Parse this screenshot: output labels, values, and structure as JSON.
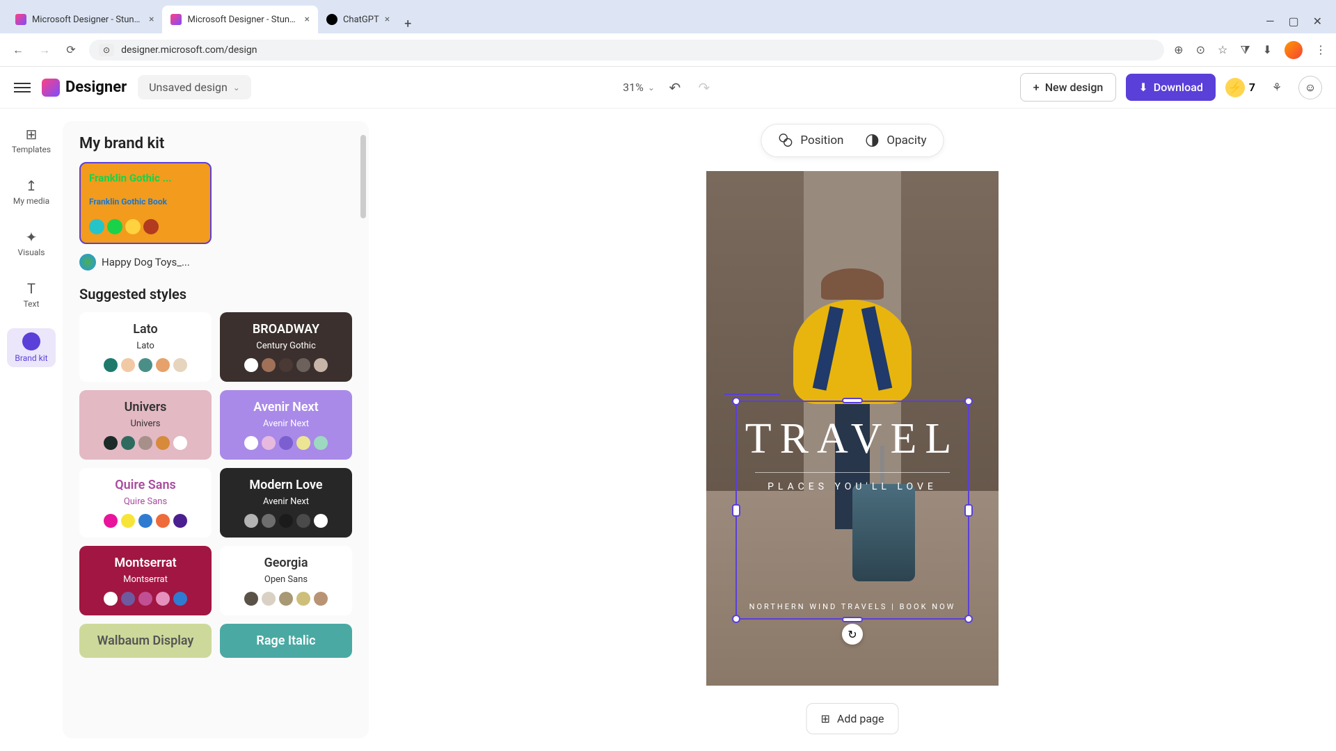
{
  "browser": {
    "tabs": [
      {
        "title": "Microsoft Designer - Stunning",
        "active": false,
        "favicon": "ms"
      },
      {
        "title": "Microsoft Designer - Stunning",
        "active": true,
        "favicon": "ms"
      },
      {
        "title": "ChatGPT",
        "active": false,
        "favicon": "gpt"
      }
    ],
    "url": "designer.microsoft.com/design"
  },
  "header": {
    "logo_text": "Designer",
    "design_name": "Unsaved design",
    "zoom": "31%",
    "new_design_label": "New design",
    "download_label": "Download",
    "credits": "7"
  },
  "nav_rail": [
    {
      "id": "templates",
      "label": "Templates",
      "icon": "⊞"
    },
    {
      "id": "my-media",
      "label": "My media",
      "icon": "↥"
    },
    {
      "id": "visuals",
      "label": "Visuals",
      "icon": "✦"
    },
    {
      "id": "text",
      "label": "Text",
      "icon": "T"
    },
    {
      "id": "brand-kit",
      "label": "Brand kit",
      "icon": "●",
      "active": true
    }
  ],
  "panel": {
    "brand_kit_title": "My brand kit",
    "brand_card": {
      "line1": "Franklin Gothic ...",
      "line2": "Franklin Gothic Book",
      "swatches": [
        "#25c4c9",
        "#19d24a",
        "#ffd23f",
        "#b23a1f"
      ]
    },
    "brand_name": "Happy Dog Toys_...",
    "suggested_title": "Suggested styles",
    "styles": [
      {
        "name1": "Lato",
        "name2": "Lato",
        "bg": "#ffffff",
        "fg": "#333",
        "swatches": [
          "#1f7a6b",
          "#f2c9a5",
          "#4a8f87",
          "#e6a26a",
          "#e7d4be"
        ]
      },
      {
        "name1": "BROADWAY",
        "name2": "Century Gothic",
        "bg": "#3b302d",
        "fg": "#fff",
        "swatches": [
          "#ffffff",
          "#a07058",
          "#4a3935",
          "#6d615c",
          "#c7b5a8"
        ]
      },
      {
        "name1": "Univers",
        "name2": "Univers",
        "bg": "#e3b9c4",
        "fg": "#333",
        "swatches": [
          "#1c2a28",
          "#2e6b5e",
          "#a78f8a",
          "#d68a3a",
          "#ffffff"
        ]
      },
      {
        "name1": "Avenir Next",
        "name2": "Avenir Next",
        "bg": "#a98ae8",
        "fg": "#fff",
        "swatches": [
          "#ffffff",
          "#e8b9df",
          "#7b5fd1",
          "#ece593",
          "#9dd9c0"
        ]
      },
      {
        "name1": "Quire Sans",
        "name2": "Quire Sans",
        "bg": "#ffffff",
        "fg": "#a84b9e",
        "swatches": [
          "#e8149b",
          "#f7e438",
          "#2f7bd1",
          "#ee6b3b",
          "#4b1f8f"
        ]
      },
      {
        "name1": "Modern Love",
        "name2": "Avenir Next",
        "bg": "#272727",
        "fg": "#fff",
        "swatches": [
          "#b4b4b4",
          "#6e6e6e",
          "#1b1b1b",
          "#4a4a4a",
          "#ffffff"
        ]
      },
      {
        "name1": "Montserrat",
        "name2": "Montserrat",
        "bg": "#a11642",
        "fg": "#fff",
        "swatches": [
          "#ffffff",
          "#6e5a9e",
          "#c14f93",
          "#e690bd",
          "#2f7bd1"
        ]
      },
      {
        "name1": "Georgia",
        "name2": "Open Sans",
        "bg": "#ffffff",
        "fg": "#333",
        "swatches": [
          "#5a5247",
          "#d9d1c4",
          "#a89873",
          "#cdbf7a",
          "#b89474"
        ]
      },
      {
        "name1": "Walbaum Display",
        "name2": "",
        "bg": "#cdd99a",
        "fg": "#555",
        "swatches": []
      },
      {
        "name1": "Rage Italic",
        "name2": "",
        "bg": "#4aa9a3",
        "fg": "#fff",
        "swatches": []
      }
    ]
  },
  "context_bar": {
    "position_label": "Position",
    "opacity_label": "Opacity"
  },
  "canvas": {
    "title": "TRAVEL",
    "subtitle": "PLACES YOU'LL LOVE",
    "footer": "NORTHERN WIND TRAVELS | BOOK NOW",
    "add_page_label": "Add page"
  }
}
